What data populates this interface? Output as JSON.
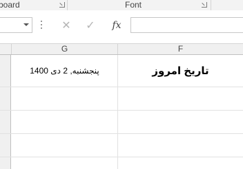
{
  "ribbon": {
    "clipboard_label": "board",
    "font_label": "Font"
  },
  "formula_bar": {
    "cancel_icon": "✕",
    "enter_icon": "✓",
    "function_icon": "fx",
    "namebox_value": "",
    "formula_value": ""
  },
  "columns": {
    "g": "G",
    "f": "F"
  },
  "cells": {
    "g_row1": "پنجشنبه, 2 دی 1400",
    "f_row1": "تاریخ امروز"
  }
}
